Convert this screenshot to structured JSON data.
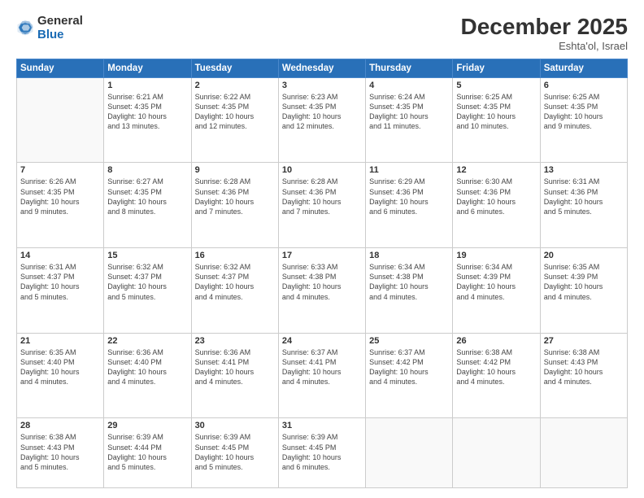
{
  "logo": {
    "general": "General",
    "blue": "Blue"
  },
  "header": {
    "month": "December 2025",
    "location": "Eshta'ol, Israel"
  },
  "weekdays": [
    "Sunday",
    "Monday",
    "Tuesday",
    "Wednesday",
    "Thursday",
    "Friday",
    "Saturday"
  ],
  "weeks": [
    [
      {
        "day": "",
        "info": ""
      },
      {
        "day": "1",
        "info": "Sunrise: 6:21 AM\nSunset: 4:35 PM\nDaylight: 10 hours\nand 13 minutes."
      },
      {
        "day": "2",
        "info": "Sunrise: 6:22 AM\nSunset: 4:35 PM\nDaylight: 10 hours\nand 12 minutes."
      },
      {
        "day": "3",
        "info": "Sunrise: 6:23 AM\nSunset: 4:35 PM\nDaylight: 10 hours\nand 12 minutes."
      },
      {
        "day": "4",
        "info": "Sunrise: 6:24 AM\nSunset: 4:35 PM\nDaylight: 10 hours\nand 11 minutes."
      },
      {
        "day": "5",
        "info": "Sunrise: 6:25 AM\nSunset: 4:35 PM\nDaylight: 10 hours\nand 10 minutes."
      },
      {
        "day": "6",
        "info": "Sunrise: 6:25 AM\nSunset: 4:35 PM\nDaylight: 10 hours\nand 9 minutes."
      }
    ],
    [
      {
        "day": "7",
        "info": "Sunrise: 6:26 AM\nSunset: 4:35 PM\nDaylight: 10 hours\nand 9 minutes."
      },
      {
        "day": "8",
        "info": "Sunrise: 6:27 AM\nSunset: 4:35 PM\nDaylight: 10 hours\nand 8 minutes."
      },
      {
        "day": "9",
        "info": "Sunrise: 6:28 AM\nSunset: 4:36 PM\nDaylight: 10 hours\nand 7 minutes."
      },
      {
        "day": "10",
        "info": "Sunrise: 6:28 AM\nSunset: 4:36 PM\nDaylight: 10 hours\nand 7 minutes."
      },
      {
        "day": "11",
        "info": "Sunrise: 6:29 AM\nSunset: 4:36 PM\nDaylight: 10 hours\nand 6 minutes."
      },
      {
        "day": "12",
        "info": "Sunrise: 6:30 AM\nSunset: 4:36 PM\nDaylight: 10 hours\nand 6 minutes."
      },
      {
        "day": "13",
        "info": "Sunrise: 6:31 AM\nSunset: 4:36 PM\nDaylight: 10 hours\nand 5 minutes."
      }
    ],
    [
      {
        "day": "14",
        "info": "Sunrise: 6:31 AM\nSunset: 4:37 PM\nDaylight: 10 hours\nand 5 minutes."
      },
      {
        "day": "15",
        "info": "Sunrise: 6:32 AM\nSunset: 4:37 PM\nDaylight: 10 hours\nand 5 minutes."
      },
      {
        "day": "16",
        "info": "Sunrise: 6:32 AM\nSunset: 4:37 PM\nDaylight: 10 hours\nand 4 minutes."
      },
      {
        "day": "17",
        "info": "Sunrise: 6:33 AM\nSunset: 4:38 PM\nDaylight: 10 hours\nand 4 minutes."
      },
      {
        "day": "18",
        "info": "Sunrise: 6:34 AM\nSunset: 4:38 PM\nDaylight: 10 hours\nand 4 minutes."
      },
      {
        "day": "19",
        "info": "Sunrise: 6:34 AM\nSunset: 4:39 PM\nDaylight: 10 hours\nand 4 minutes."
      },
      {
        "day": "20",
        "info": "Sunrise: 6:35 AM\nSunset: 4:39 PM\nDaylight: 10 hours\nand 4 minutes."
      }
    ],
    [
      {
        "day": "21",
        "info": "Sunrise: 6:35 AM\nSunset: 4:40 PM\nDaylight: 10 hours\nand 4 minutes."
      },
      {
        "day": "22",
        "info": "Sunrise: 6:36 AM\nSunset: 4:40 PM\nDaylight: 10 hours\nand 4 minutes."
      },
      {
        "day": "23",
        "info": "Sunrise: 6:36 AM\nSunset: 4:41 PM\nDaylight: 10 hours\nand 4 minutes."
      },
      {
        "day": "24",
        "info": "Sunrise: 6:37 AM\nSunset: 4:41 PM\nDaylight: 10 hours\nand 4 minutes."
      },
      {
        "day": "25",
        "info": "Sunrise: 6:37 AM\nSunset: 4:42 PM\nDaylight: 10 hours\nand 4 minutes."
      },
      {
        "day": "26",
        "info": "Sunrise: 6:38 AM\nSunset: 4:42 PM\nDaylight: 10 hours\nand 4 minutes."
      },
      {
        "day": "27",
        "info": "Sunrise: 6:38 AM\nSunset: 4:43 PM\nDaylight: 10 hours\nand 4 minutes."
      }
    ],
    [
      {
        "day": "28",
        "info": "Sunrise: 6:38 AM\nSunset: 4:43 PM\nDaylight: 10 hours\nand 5 minutes."
      },
      {
        "day": "29",
        "info": "Sunrise: 6:39 AM\nSunset: 4:44 PM\nDaylight: 10 hours\nand 5 minutes."
      },
      {
        "day": "30",
        "info": "Sunrise: 6:39 AM\nSunset: 4:45 PM\nDaylight: 10 hours\nand 5 minutes."
      },
      {
        "day": "31",
        "info": "Sunrise: 6:39 AM\nSunset: 4:45 PM\nDaylight: 10 hours\nand 6 minutes."
      },
      {
        "day": "",
        "info": ""
      },
      {
        "day": "",
        "info": ""
      },
      {
        "day": "",
        "info": ""
      }
    ]
  ]
}
